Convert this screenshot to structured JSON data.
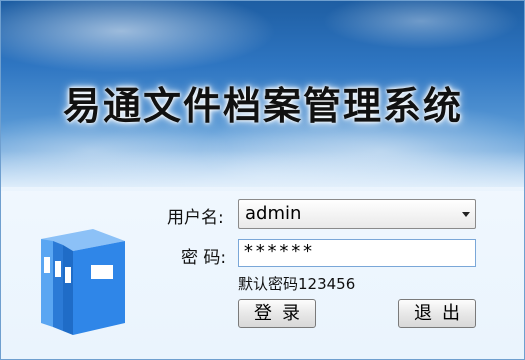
{
  "app": {
    "title": "易通文件档案管理系统"
  },
  "form": {
    "username_label": "用户名:",
    "username_value": "admin",
    "password_label": "密 码:",
    "password_value": "******",
    "hint": "默认密码123456"
  },
  "buttons": {
    "login": "登录",
    "exit": "退出"
  },
  "icons": {
    "logo": "binder-folders-icon",
    "dropdown": "chevron-down-icon"
  },
  "colors": {
    "folder_blue": "#2f86e8",
    "sky_top": "#1e5ea3",
    "input_border": "#7aa7d8"
  }
}
